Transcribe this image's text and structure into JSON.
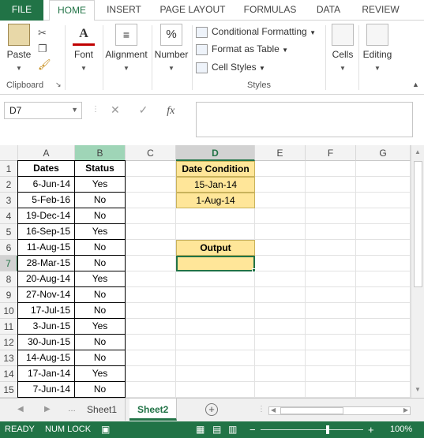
{
  "ribbon_tabs": [
    "FILE",
    "HOME",
    "INSERT",
    "PAGE LAYOUT",
    "FORMULAS",
    "DATA",
    "REVIEW"
  ],
  "ribbon": {
    "paste": "Paste",
    "clipboard": "Clipboard",
    "font": "Font",
    "alignment": "Alignment",
    "number": "Number",
    "conditional_formatting": "Conditional Formatting",
    "format_as_table": "Format as Table",
    "cell_styles": "Cell Styles",
    "styles": "Styles",
    "cells": "Cells",
    "editing": "Editing"
  },
  "formula_bar": {
    "name_box": "D7",
    "fx": "fx",
    "value": ""
  },
  "columns": [
    "A",
    "B",
    "C",
    "D",
    "E",
    "F",
    "G"
  ],
  "rows": [
    "1",
    "2",
    "3",
    "4",
    "5",
    "6",
    "7",
    "8",
    "9",
    "10",
    "11",
    "12",
    "13",
    "14",
    "15"
  ],
  "table": {
    "header_dates": "Dates",
    "header_status": "Status",
    "dates": [
      "6-Jun-14",
      "5-Feb-16",
      "19-Dec-14",
      "16-Sep-15",
      "11-Aug-15",
      "28-Mar-15",
      "20-Aug-14",
      "27-Nov-14",
      "17-Jul-15",
      "3-Jun-15",
      "30-Jun-15",
      "14-Aug-15",
      "17-Jan-14",
      "7-Jun-14"
    ],
    "status": [
      "Yes",
      "No",
      "No",
      "Yes",
      "No",
      "No",
      "Yes",
      "No",
      "No",
      "Yes",
      "No",
      "No",
      "Yes",
      "No"
    ]
  },
  "condition": {
    "header": "Date Condition",
    "values": [
      "15-Jan-14",
      "1-Aug-14"
    ],
    "output_label": "Output",
    "output_value": ""
  },
  "sheets": [
    "Sheet1",
    "Sheet2"
  ],
  "active_sheet": "Sheet2",
  "status_bar": {
    "ready": "READY",
    "numlock": "NUM LOCK",
    "zoom": "100%",
    "zoom_minus": "−",
    "zoom_plus": "+"
  },
  "colors": {
    "excel_green": "#217346",
    "highlight_yellow": "#ffe699"
  }
}
